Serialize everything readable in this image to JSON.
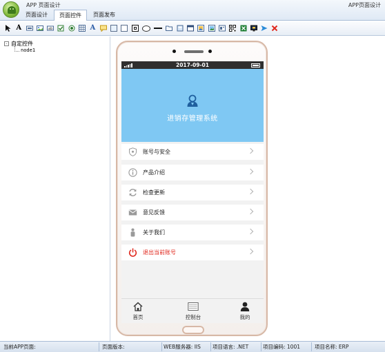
{
  "window": {
    "title": "APP 页面设计",
    "title_right": "APP页面设计"
  },
  "tabs": [
    {
      "label": "页面设计",
      "active": false
    },
    {
      "label": "页面控件",
      "active": true
    },
    {
      "label": "页面发布",
      "active": false
    }
  ],
  "toolbar": {
    "icons": [
      "pointer-icon",
      "text-icon",
      "label-icon",
      "image-icon",
      "textbox-icon",
      "checkbox-icon",
      "radio-icon",
      "table-icon",
      "font-icon",
      "comment-icon",
      "panel-icon",
      "rectangle-icon",
      "filled-rect-icon",
      "ellipse-icon",
      "line-icon",
      "folder-icon",
      "document-icon",
      "window-icon",
      "picture-icon",
      "gallery-icon",
      "frame-icon",
      "qrcode-icon",
      "excel-icon",
      "monitor-icon",
      "send-icon",
      "delete-icon"
    ],
    "text_glyphs": [
      "A",
      "A"
    ]
  },
  "tree": {
    "expander": "-",
    "root_label": "自定控件",
    "child_label": "node1"
  },
  "phone": {
    "status_time": "2017-09-01",
    "banner_title": "进销存管理系统",
    "menu": [
      {
        "label": "账号与安全",
        "icon": "shield-icon",
        "danger": false
      },
      {
        "label": "产品介绍",
        "icon": "info-icon",
        "danger": false
      },
      {
        "label": "检查更新",
        "icon": "refresh-icon",
        "danger": false
      },
      {
        "label": "意见反馈",
        "icon": "mail-icon",
        "danger": false
      },
      {
        "label": "关于我们",
        "icon": "person-icon",
        "danger": false
      },
      {
        "label": "退出当前账号",
        "icon": "power-icon",
        "danger": true
      }
    ],
    "nav": [
      {
        "label": "首页",
        "icon": "home-icon"
      },
      {
        "label": "控制台",
        "icon": "keyboard-icon"
      },
      {
        "label": "我的",
        "icon": "user-icon"
      }
    ]
  },
  "statusbar": {
    "current_page": "当前APP页面:",
    "page_version": "页面版本:",
    "web_server": "WEB服务器: IIS",
    "language": "项目语言: .NET",
    "project_code": "项目编码: 1001",
    "project_name": "项目名称: ERP"
  },
  "colors": {
    "banner": "#7fc8f3",
    "danger": "#e0281e",
    "phone_frame": "#d7b8a6"
  }
}
